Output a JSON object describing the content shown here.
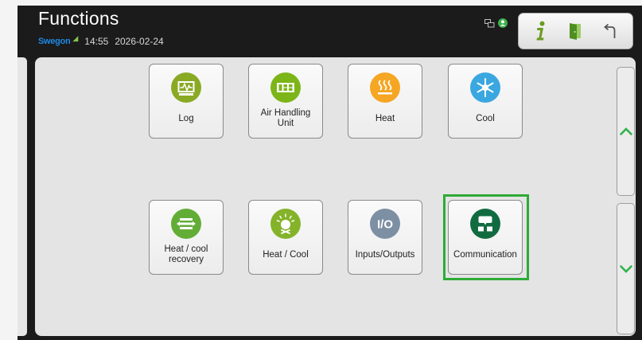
{
  "header": {
    "title": "Functions",
    "brand": "Swegon",
    "time": "14:55",
    "date": "2026-02-24"
  },
  "status_icons": [
    "network-icon",
    "user-icon"
  ],
  "toolbar": {
    "buttons": [
      {
        "name": "info-icon",
        "color": "#6a9b1f"
      },
      {
        "name": "door-exit-icon",
        "color": "#4f8f21"
      },
      {
        "name": "back-arrow-icon",
        "color": "#555555"
      }
    ]
  },
  "tiles": [
    {
      "label": "Log",
      "icon": "log-monitor-icon",
      "color": "#8aaa24"
    },
    {
      "label": "Air Handling Unit",
      "icon": "air-handling-unit-icon",
      "color": "#7cb518"
    },
    {
      "label": "Heat",
      "icon": "heat-icon",
      "color": "#f5a623"
    },
    {
      "label": "Cool",
      "icon": "snowflake-icon",
      "color": "#3aa7e0"
    },
    {
      "label": "Heat / cool recovery",
      "icon": "recovery-icon",
      "color": "#62ad36"
    },
    {
      "label": "Heat / Cool",
      "icon": "heat-cool-icon",
      "color": "#84b32a"
    },
    {
      "label": "Inputs/Outputs",
      "icon": "io-icon",
      "color": "#7d8fa3"
    },
    {
      "label": "Communication",
      "icon": "communication-icon",
      "color": "#116b41",
      "selected": true
    }
  ],
  "scroll": {
    "up_icon": "chevron-up-icon",
    "down_icon": "chevron-down-icon",
    "color": "#31b34a"
  }
}
